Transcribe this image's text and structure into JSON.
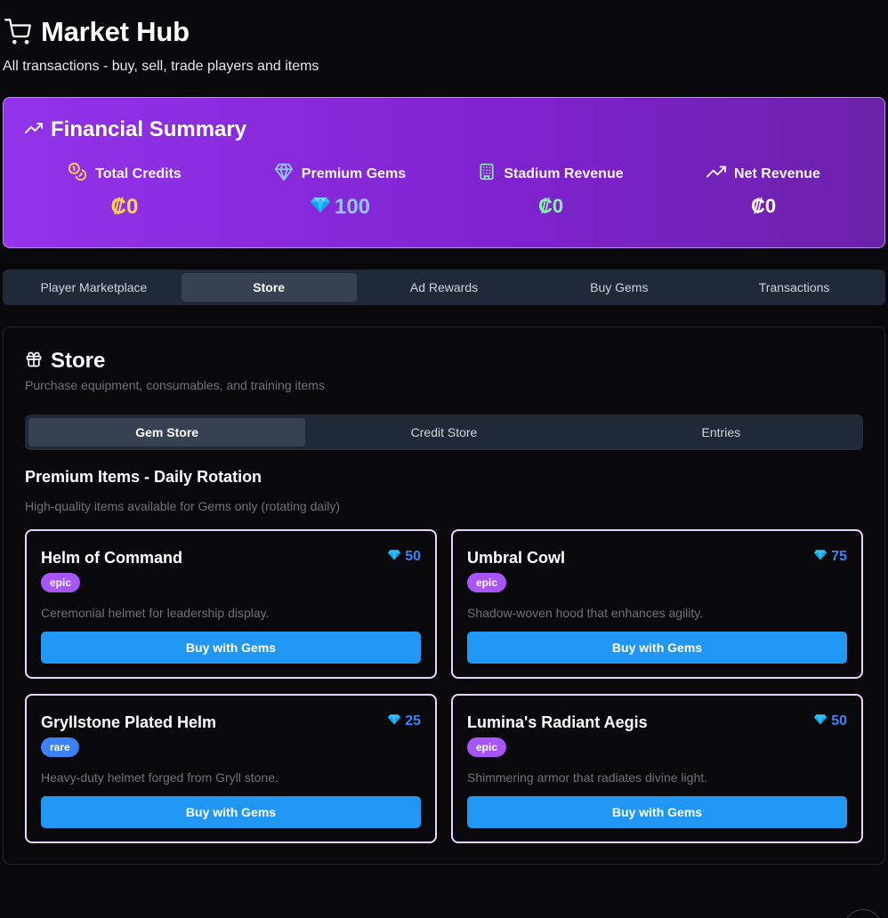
{
  "header": {
    "title": "Market Hub",
    "subtitle": "All transactions - buy, sell, trade players and items"
  },
  "summary": {
    "title": "Financial Summary",
    "stats": [
      {
        "label": "Total Credits",
        "value": "₡0",
        "icon": "coins-icon",
        "color": "#fcd34d"
      },
      {
        "label": "Premium Gems",
        "value": "100",
        "icon": "gem-icon",
        "color": "#93c5fd"
      },
      {
        "label": "Stadium Revenue",
        "value": "₡0",
        "icon": "building-icon",
        "color": "#86efac"
      },
      {
        "label": "Net Revenue",
        "value": "₡0",
        "icon": "trending-up-icon",
        "color": "#ffffff"
      }
    ]
  },
  "tabs": [
    {
      "label": "Player Marketplace",
      "active": false
    },
    {
      "label": "Store",
      "active": true
    },
    {
      "label": "Ad Rewards",
      "active": false
    },
    {
      "label": "Buy Gems",
      "active": false
    },
    {
      "label": "Transactions",
      "active": false
    }
  ],
  "store": {
    "title": "Store",
    "subtitle": "Purchase equipment, consumables, and training items",
    "subtabs": [
      {
        "label": "Gem Store",
        "active": true
      },
      {
        "label": "Credit Store",
        "active": false
      },
      {
        "label": "Entries",
        "active": false
      }
    ],
    "section_title": "Premium Items - Daily Rotation",
    "section_subtitle": "High-quality items available for Gems only (rotating daily)",
    "items": [
      {
        "name": "Helm of Command",
        "price": "50",
        "rarity": "epic",
        "description": "Ceremonial helmet for leadership display.",
        "button": "Buy with Gems"
      },
      {
        "name": "Umbral Cowl",
        "price": "75",
        "rarity": "epic",
        "description": "Shadow-woven hood that enhances agility.",
        "button": "Buy with Gems"
      },
      {
        "name": "Gryllstone Plated Helm",
        "price": "25",
        "rarity": "rare",
        "description": "Heavy-duty helmet forged from Gryll stone.",
        "button": "Buy with Gems"
      },
      {
        "name": "Lumina's Radiant Aegis",
        "price": "50",
        "rarity": "epic",
        "description": "Shimmering armor that radiates divine light.",
        "button": "Buy with Gems"
      }
    ]
  },
  "colors": {
    "accent": "#2196f3",
    "epic": "#a855f7",
    "rare": "#3b82f6",
    "summary_gradient_start": "#9333ea",
    "summary_gradient_end": "#6b21a8"
  }
}
